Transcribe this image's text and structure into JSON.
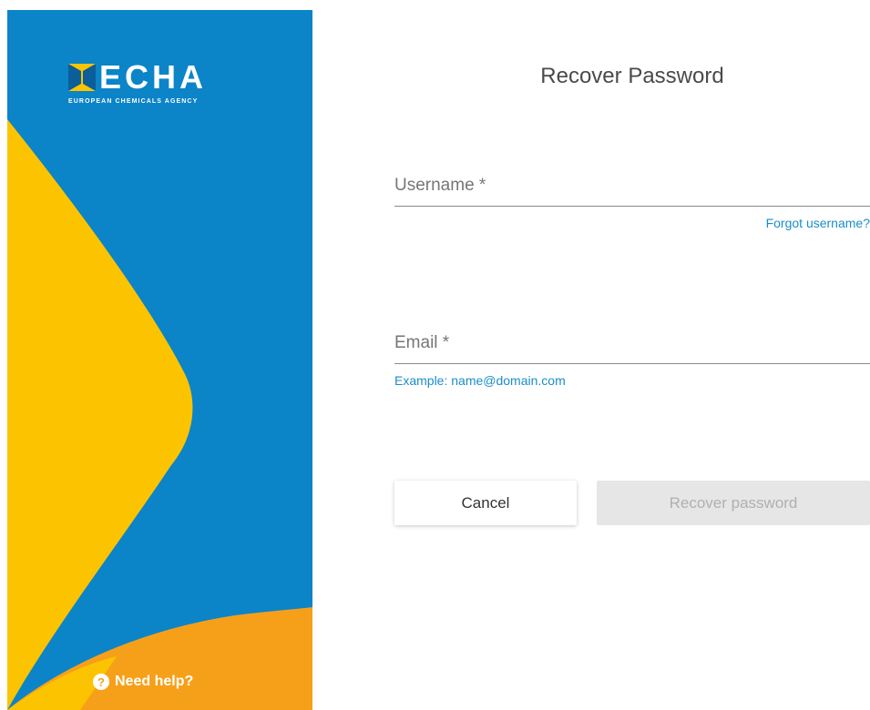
{
  "brand": {
    "name": "ECHA",
    "subtitle": "EUROPEAN CHEMICALS AGENCY",
    "colors": {
      "blue": "#0b84c8",
      "yellow": "#fcc400",
      "orange": "#f6a01a"
    }
  },
  "help": {
    "icon": "question-circle-icon",
    "label": "Need help?"
  },
  "form": {
    "title": "Recover Password",
    "username": {
      "placeholder": "Username *",
      "value": ""
    },
    "forgot_username_link": "Forgot username?",
    "email": {
      "placeholder": "Email *",
      "value": "",
      "hint": "Example: name@domain.com"
    },
    "buttons": {
      "cancel": "Cancel",
      "recover": "Recover password"
    },
    "accent_color": "#1a8ec8"
  }
}
